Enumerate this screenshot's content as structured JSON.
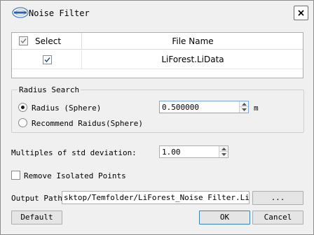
{
  "window": {
    "title": "Noise Filter",
    "close_icon": "close-icon",
    "logo_icon": "liforest-logo-icon"
  },
  "table": {
    "columns": [
      "Select",
      "File Name"
    ],
    "rows": [
      {
        "selected": true,
        "file_name": "LiForest.LiData"
      }
    ]
  },
  "radius_search": {
    "group_label": "Radius Search",
    "radius_option": "Radius (Sphere)",
    "radius_value": "0.500000",
    "radius_unit": "m",
    "recommend_option": "Recommend Raidus(Sphere)",
    "selected": "radius"
  },
  "std_dev": {
    "label": "Multiples of std deviation:",
    "value": "1.00"
  },
  "remove_isolated": {
    "label": "Remove Isolated Points",
    "checked": false
  },
  "output": {
    "label": "Output Path:",
    "value": "sktop/Temfolder/LiForest_Noise Filter.LiData",
    "browse_label": "..."
  },
  "buttons": {
    "default": "Default",
    "ok": "OK",
    "cancel": "Cancel"
  },
  "colors": {
    "background": "#f0f0f0",
    "focus_border": "#7aa7d6",
    "checkbox_check": "#2d4e8c"
  }
}
